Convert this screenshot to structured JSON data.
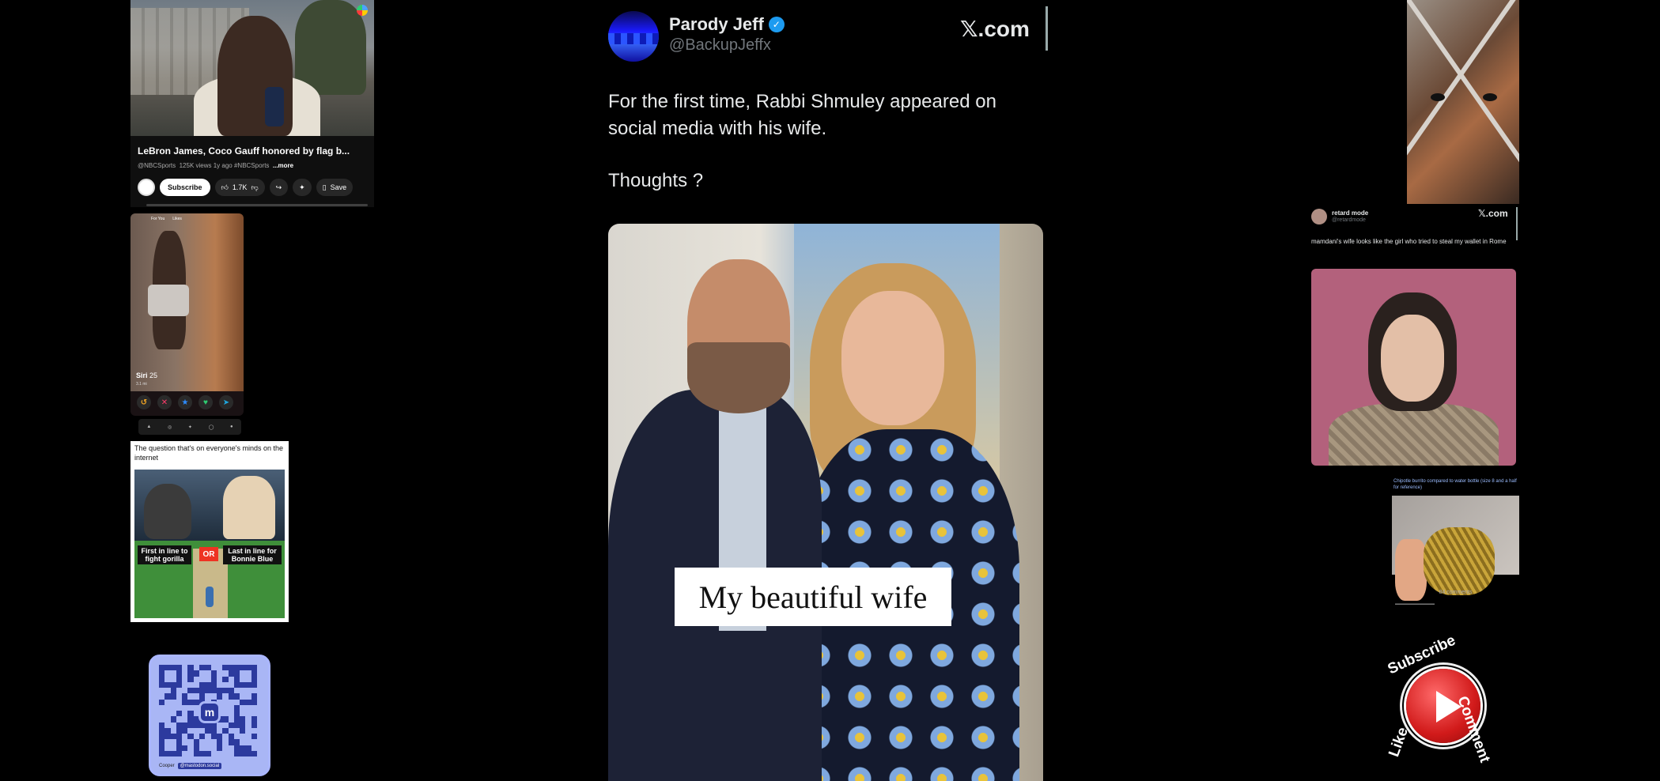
{
  "youtube": {
    "title": "LeBron James, Coco Gauff honored by flag b...",
    "channel": "@NBCSports",
    "meta": "125K views  1y ago  #NBCSports",
    "more": "...more",
    "subscribe_label": "Subscribe",
    "likes": "1.7K",
    "save_label": "Save"
  },
  "dating": {
    "tab_for_you": "For You",
    "tab_likes": "Likes",
    "name": "Siri",
    "age": "25",
    "location": "3.1 mi"
  },
  "meme": {
    "caption": "The question that's on everyone's minds on the internet",
    "left_label": "First in line to fight gorilla",
    "or_label": "OR",
    "right_label": "Last in line for Bonnie Blue"
  },
  "qr": {
    "logo_letter": "m",
    "footer_user": "Cooper",
    "footer_tag": "@mastodon.social"
  },
  "main_tweet": {
    "display_name": "Parody Jeff",
    "handle": "@BackupJeffx",
    "brand": "𝕏.com",
    "text": "For the first time, Rabbi Shmuley appeared on social media with his wife.",
    "text2": "Thoughts ?",
    "photo_caption": "My beautiful wife",
    "verified_icon": "verified-badge-icon"
  },
  "right_tweet": {
    "display_name": "retard mode",
    "handle": "@retardmode",
    "brand": "𝕏.com",
    "text": "mamdani's wife looks like the girl who tried to steal my wallet in Rome"
  },
  "burrito_card": {
    "text": "Chipotle burrito compared to water bottle (size 8 and a half for reference)",
    "comments": "84 comments"
  },
  "subscribe_badge": {
    "subscribe": "Subscribe",
    "comment": "Comment",
    "like": "Like"
  },
  "colors": {
    "verified_blue": "#1d9bf0",
    "background": "#000000",
    "youtube_red": "#d11a1a"
  }
}
